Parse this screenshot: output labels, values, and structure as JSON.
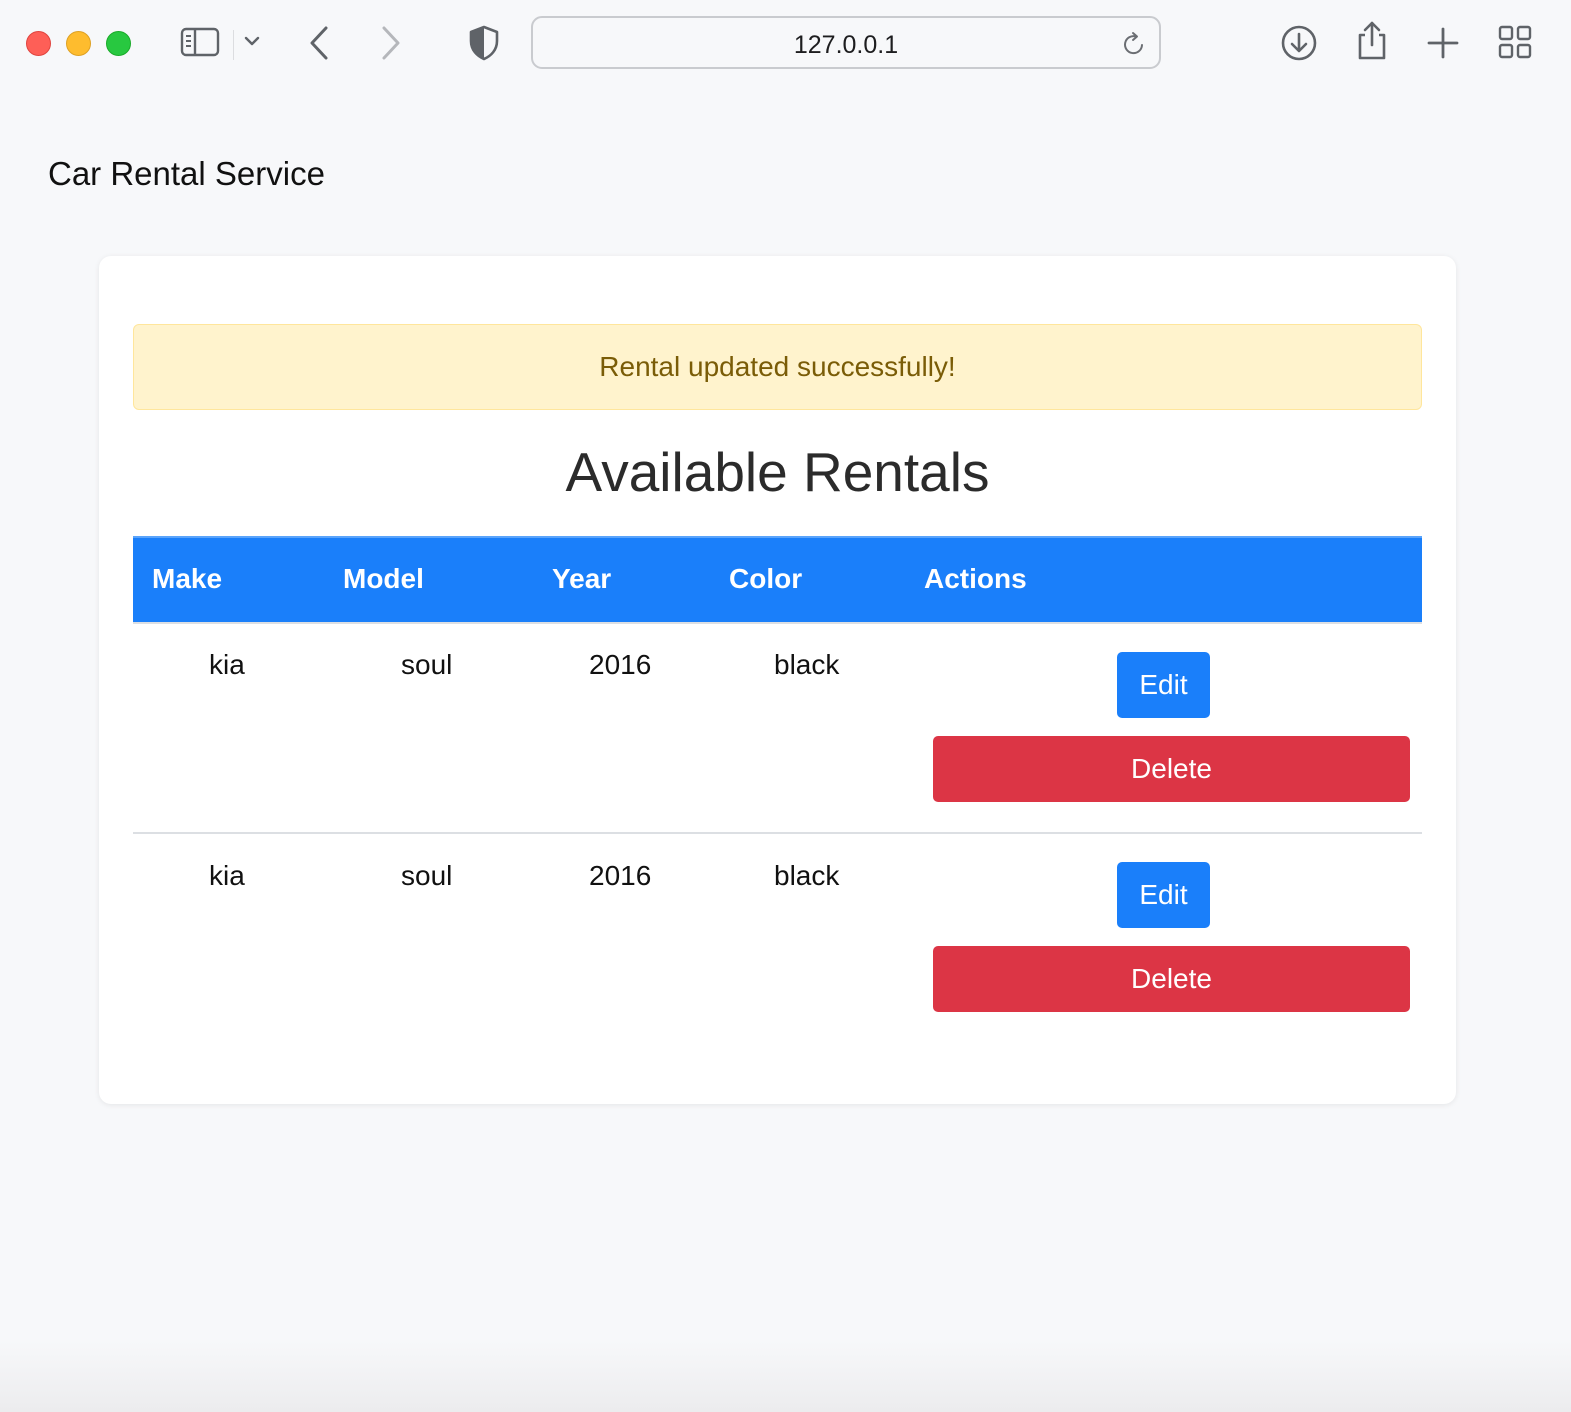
{
  "browser": {
    "url": "127.0.0.1",
    "icons": {
      "sidebar": "sidebar-icon",
      "sidebar_menu": "chevron-down-icon",
      "back": "chevron-left-icon",
      "forward": "chevron-right-icon",
      "privacy": "shield-icon",
      "reload": "reload-icon",
      "downloads": "download-icon",
      "share": "share-icon",
      "new_tab": "plus-icon",
      "tab_overview": "grid-icon"
    }
  },
  "page": {
    "brand": "Car Rental Service",
    "alert": "Rental updated successfully!",
    "heading": "Available Rentals",
    "table": {
      "headers": [
        "Make",
        "Model",
        "Year",
        "Color",
        "Actions"
      ],
      "rows": [
        {
          "make": "kia",
          "model": "soul",
          "year": "2016",
          "color": "black",
          "edit_label": "Edit",
          "delete_label": "Delete"
        },
        {
          "make": "kia",
          "model": "soul",
          "year": "2016",
          "color": "black",
          "edit_label": "Edit",
          "delete_label": "Delete"
        }
      ]
    }
  },
  "colors": {
    "primary": "#1a7ffa",
    "danger": "#dc3545",
    "alert_bg": "#fff3cd",
    "alert_text": "#7a5c07"
  }
}
